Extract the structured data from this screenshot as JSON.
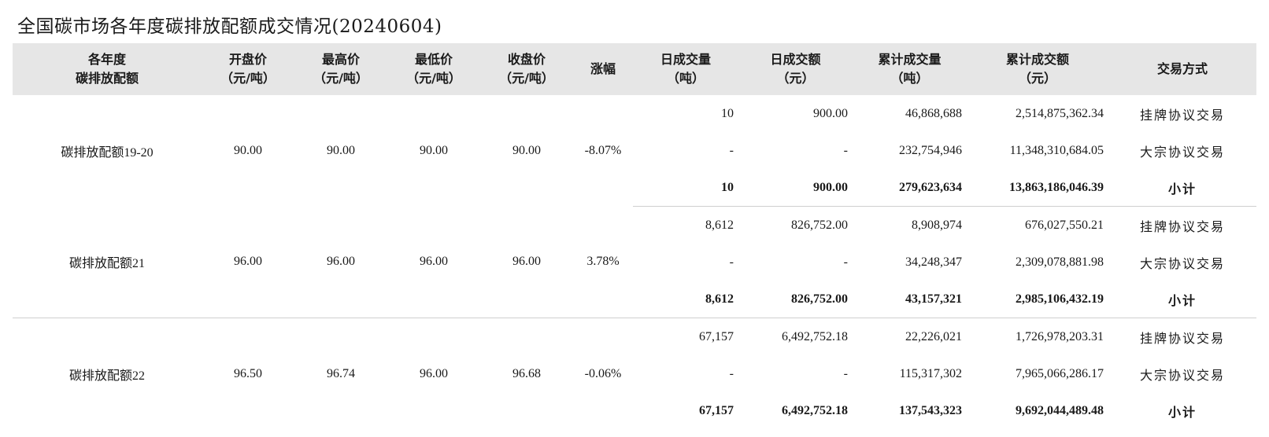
{
  "title": "全国碳市场各年度碳排放配额成交情况(20240604)",
  "headers": [
    {
      "l1": "各年度",
      "l2": "碳排放配额"
    },
    {
      "l1": "开盘价",
      "l2": "（元/吨）"
    },
    {
      "l1": "最高价",
      "l2": "（元/吨）"
    },
    {
      "l1": "最低价",
      "l2": "（元/吨）"
    },
    {
      "l1": "收盘价",
      "l2": "（元/吨）"
    },
    {
      "l1": "涨幅",
      "l2": ""
    },
    {
      "l1": "日成交量",
      "l2": "（吨）"
    },
    {
      "l1": "日成交额",
      "l2": "（元）"
    },
    {
      "l1": "累计成交量",
      "l2": "（吨）"
    },
    {
      "l1": "累计成交额",
      "l2": "（元）"
    },
    {
      "l1": "交易方式",
      "l2": ""
    }
  ],
  "groups": [
    {
      "name": "碳排放配额19-20",
      "open": "90.00",
      "high": "90.00",
      "low": "90.00",
      "close": "90.00",
      "change": "-8.07%",
      "rows": [
        {
          "vol": "10",
          "amt": "900.00",
          "cum_vol": "46,868,688",
          "cum_amt": "2,514,875,362.34",
          "mode": "挂牌协议交易"
        },
        {
          "vol": "-",
          "amt": "-",
          "cum_vol": "232,754,946",
          "cum_amt": "11,348,310,684.05",
          "mode": "大宗协议交易"
        },
        {
          "vol": "10",
          "amt": "900.00",
          "cum_vol": "279,623,634",
          "cum_amt": "13,863,186,046.39",
          "mode": "小计"
        }
      ]
    },
    {
      "name": "碳排放配额21",
      "open": "96.00",
      "high": "96.00",
      "low": "96.00",
      "close": "96.00",
      "change": "3.78%",
      "rows": [
        {
          "vol": "8,612",
          "amt": "826,752.00",
          "cum_vol": "8,908,974",
          "cum_amt": "676,027,550.21",
          "mode": "挂牌协议交易"
        },
        {
          "vol": "-",
          "amt": "-",
          "cum_vol": "34,248,347",
          "cum_amt": "2,309,078,881.98",
          "mode": "大宗协议交易"
        },
        {
          "vol": "8,612",
          "amt": "826,752.00",
          "cum_vol": "43,157,321",
          "cum_amt": "2,985,106,432.19",
          "mode": "小计"
        }
      ]
    },
    {
      "name": "碳排放配额22",
      "open": "96.50",
      "high": "96.74",
      "low": "96.00",
      "close": "96.68",
      "change": "-0.06%",
      "rows": [
        {
          "vol": "67,157",
          "amt": "6,492,752.18",
          "cum_vol": "22,226,021",
          "cum_amt": "1,726,978,203.31",
          "mode": "挂牌协议交易"
        },
        {
          "vol": "-",
          "amt": "-",
          "cum_vol": "115,317,302",
          "cum_amt": "7,965,066,286.17",
          "mode": "大宗协议交易"
        },
        {
          "vol": "67,157",
          "amt": "6,492,752.18",
          "cum_vol": "137,543,323",
          "cum_amt": "9,692,044,489.48",
          "mode": "小计"
        }
      ]
    }
  ]
}
